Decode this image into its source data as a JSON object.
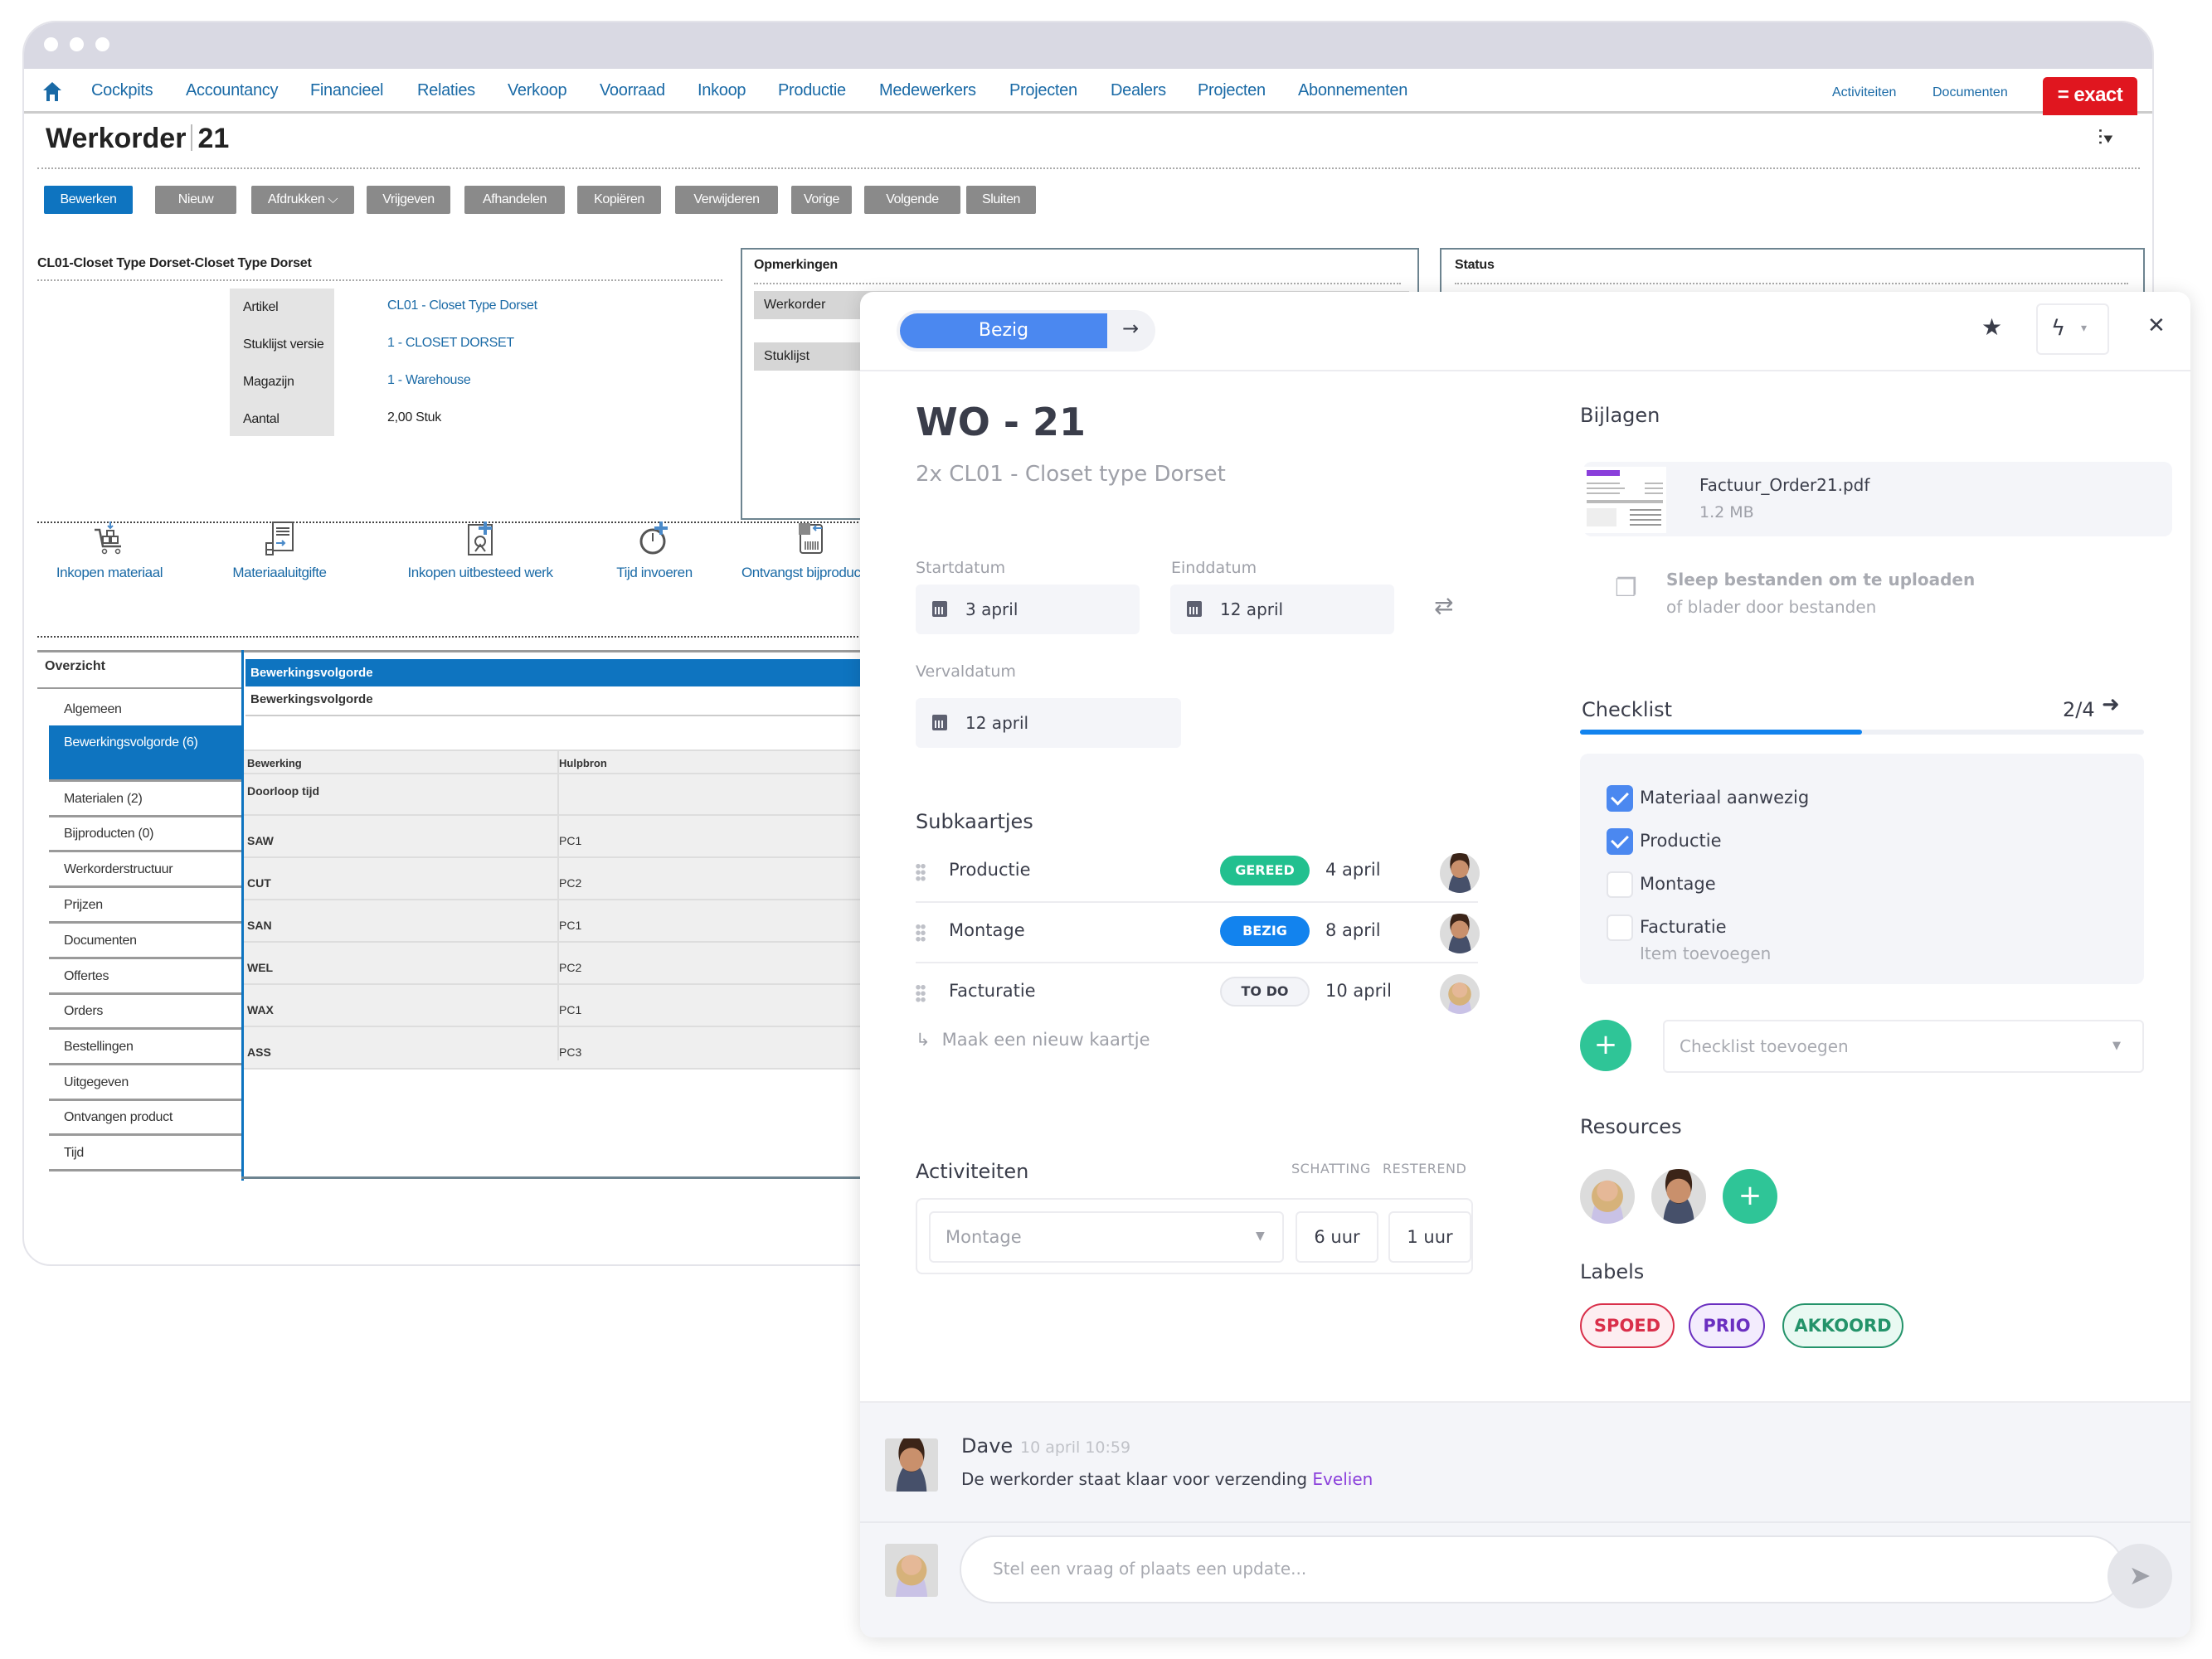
{
  "window": {
    "nav": {
      "items": [
        "Cockpits",
        "Accountancy",
        "Financieel",
        "Relaties",
        "Verkoop",
        "Voorraad",
        "Inkoop",
        "Productie",
        "Medewerkers",
        "Projecten",
        "Dealers",
        "Projecten",
        "Abonnementen"
      ],
      "right_links": [
        "Activiteiten",
        "Documenten"
      ],
      "brand": "= exact"
    },
    "page_title": {
      "main": "Werkorder",
      "number": "21"
    },
    "toolbar": [
      "Bewerken",
      "Nieuw",
      "Afdrukken ⌵",
      "Vrijgeven",
      "Afhandelen",
      "Kopiëren",
      "Verwijderen",
      "Vorige",
      "Volgende",
      "Sluiten"
    ],
    "product_section": {
      "title": "CL01-Closet Type Dorset-Closet Type Dorset",
      "rows": [
        {
          "label": "Artikel",
          "value": "CL01 - Closet Type Dorset"
        },
        {
          "label": "Stuklijst versie",
          "value": "1 - CLOSET DORSET"
        },
        {
          "label": "Magazijn",
          "value": "1 - Warehouse"
        },
        {
          "label": "Aantal",
          "value": "2,00 Stuk"
        }
      ]
    },
    "remarks": {
      "title": "Opmerkingen",
      "fields": [
        "Werkorder",
        "Stuklijst"
      ]
    },
    "status_box": {
      "title": "Status"
    },
    "actions": [
      "Inkopen materiaal",
      "Materiaaluitgifte",
      "Inkopen uitbesteed werk",
      "Tijd invoeren",
      "Ontvangst bijproducten"
    ],
    "sidebar": {
      "header": "Overzicht",
      "items": [
        "Algemeen",
        "Bewerkingsvolgorde (6)",
        "Materialen (2)",
        "Bijproducten (0)",
        "Werkorderstructuur",
        "Prijzen",
        "Documenten",
        "Offertes",
        "Orders",
        "Bestellingen",
        "Uitgegeven",
        "Ontvangen product",
        "Tijd"
      ],
      "active_index": 1
    },
    "operations": {
      "tab": "Bewerkingsvolgorde",
      "subtitle": "Bewerkingsvolgorde",
      "columns": [
        "Bewerking",
        "Hulpbron"
      ],
      "rows": [
        [
          "Doorloop tijd",
          ""
        ],
        [
          "SAW",
          "PC1"
        ],
        [
          "CUT",
          "PC2"
        ],
        [
          "SAN",
          "PC1"
        ],
        [
          "WEL",
          "PC2"
        ],
        [
          "WAX",
          "PC1"
        ],
        [
          "ASS",
          "PC3"
        ]
      ]
    }
  },
  "card": {
    "status": "Bezig",
    "title": "WO - 21",
    "subtitle": "2x CL01 - Closet type Dorset",
    "dates": {
      "start_label": "Startdatum",
      "start": "3 april",
      "end_label": "Einddatum",
      "end": "12 april",
      "due_label": "Vervaldatum",
      "due": "12 april"
    },
    "subcards": {
      "title": "Subkaartjes",
      "items": [
        {
          "name": "Productie",
          "status": "GEREED",
          "date": "4 april",
          "status_color": "#22c08f",
          "assignee": "male"
        },
        {
          "name": "Montage",
          "status": "BEZIG",
          "date": "8 april",
          "status_color": "#1283ee",
          "assignee": "male"
        },
        {
          "name": "Facturatie",
          "status": "TO DO",
          "date": "10 april",
          "status_color": "#f3f4f8",
          "assignee": "female"
        }
      ],
      "new_card": "Maak een nieuw kaartje"
    },
    "activities": {
      "title": "Activiteiten",
      "col_estimate": "SCHATTING",
      "col_remaining": "RESTEREND",
      "activity": "Montage",
      "estimate": "6 uur",
      "remaining": "1 uur"
    },
    "attachments": {
      "title": "Bijlagen",
      "file_name": "Factuur_Order21.pdf",
      "file_size": "1.2 MB",
      "upload_primary": "Sleep bestanden om te uploaden",
      "upload_secondary": "of blader door bestanden"
    },
    "checklist": {
      "title": "Checklist",
      "count": "2/4",
      "progress": 0.5,
      "items": [
        {
          "label": "Materiaal aanwezig",
          "checked": true
        },
        {
          "label": "Productie",
          "checked": true
        },
        {
          "label": "Montage",
          "checked": false
        },
        {
          "label": "Facturatie",
          "checked": false
        }
      ],
      "add_item": "Item toevoegen",
      "add_checklist_placeholder": "Checklist toevoegen"
    },
    "resources": {
      "title": "Resources"
    },
    "labels": {
      "title": "Labels",
      "items": [
        {
          "text": "SPOED",
          "color": "#d92f4a",
          "bg": "#fdeef1"
        },
        {
          "text": "PRIO",
          "color": "#6a2fc0",
          "bg": "#f3ecfd"
        },
        {
          "text": "AKKOORD",
          "color": "#24936a",
          "bg": "#e9f9f2"
        }
      ]
    },
    "comment": {
      "author": "Dave",
      "time": "10 april 10:59",
      "text": "De werkorder staat klaar voor verzending",
      "mention": "Evelien"
    },
    "composer": {
      "placeholder": "Stel een vraag of plaats een update..."
    }
  }
}
